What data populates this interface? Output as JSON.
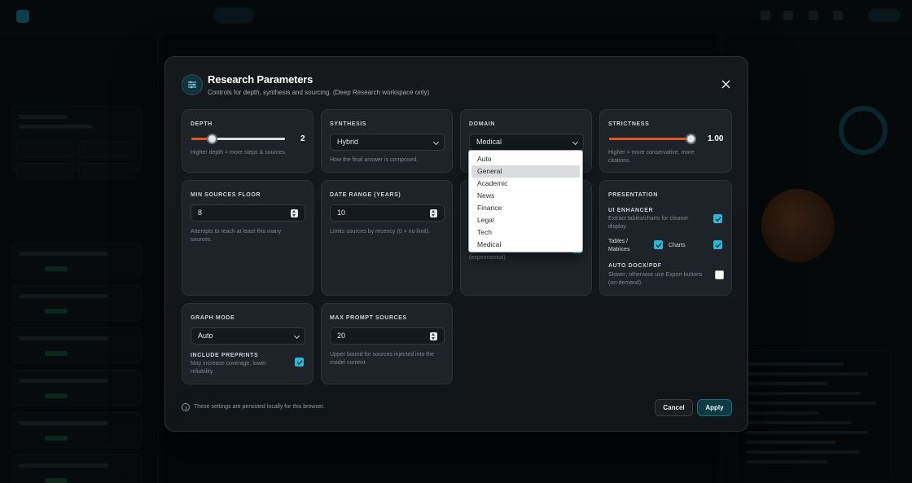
{
  "modal": {
    "title": "Research Parameters",
    "subtitle": "Controls for depth, synthesis and sourcing. (Deep Research workspace only)",
    "depth": {
      "label": "DEPTH",
      "value": "2",
      "fraction": 0.22,
      "hint": "Higher depth = more steps & sources."
    },
    "synthesis": {
      "label": "SYNTHESIS",
      "selected": "Hybrid",
      "hint": "How the final answer is composed."
    },
    "domain": {
      "label": "DOMAIN",
      "selected": "Medical",
      "options": [
        "Auto",
        "General",
        "Academic",
        "News",
        "Finance",
        "Legal",
        "Tech",
        "Medical"
      ],
      "highlighted": "General",
      "hidden_hint": "(experimental)."
    },
    "strictness": {
      "label": "STRICTNESS",
      "value": "1.00",
      "fraction": 1.0,
      "hint": "Higher = more conservative, more citations."
    },
    "min_sources": {
      "label": "MIN SOURCES FLOOR",
      "value": "8",
      "hint": "Attempts to reach at least this many sources."
    },
    "date_range": {
      "label": "DATE RANGE (YEARS)",
      "value": "10",
      "hint": "Limits sources by recency (0 = no limit)."
    },
    "presentation": {
      "label": "PRESENTATION",
      "ui_enhancer": {
        "title": "UI ENHANCER",
        "desc": "Extract tables/charts for cleaner display.",
        "checked": true
      },
      "tables": {
        "label": "Tables / Matrices",
        "checked": true
      },
      "charts": {
        "label": "Charts",
        "checked": true
      },
      "auto_docx": {
        "title": "AUTO DOCX/PDF",
        "desc": "Slower; otherwise use Export buttons (on-demand).",
        "checked": false
      }
    },
    "graph_mode": {
      "label": "GRAPH MODE",
      "selected": "Auto",
      "preprints_title": "INCLUDE PREPRINTS",
      "preprints_desc": "May increase coverage, lower reliability.",
      "preprints_checked": true
    },
    "max_prompt": {
      "label": "MAX PROMPT SOURCES",
      "value": "20",
      "hint": "Upper bound for sources injected into the model context."
    },
    "footer_note": "These settings are persisted locally for this browser.",
    "cancel_label": "Cancel",
    "apply_label": "Apply"
  },
  "colors": {
    "accent": "#28b7d6",
    "slider": "#e2532a",
    "apply_bg": "#0f3a44"
  },
  "icons": {
    "header": "sliders-icon",
    "close": "close-icon",
    "info": "info-icon"
  }
}
